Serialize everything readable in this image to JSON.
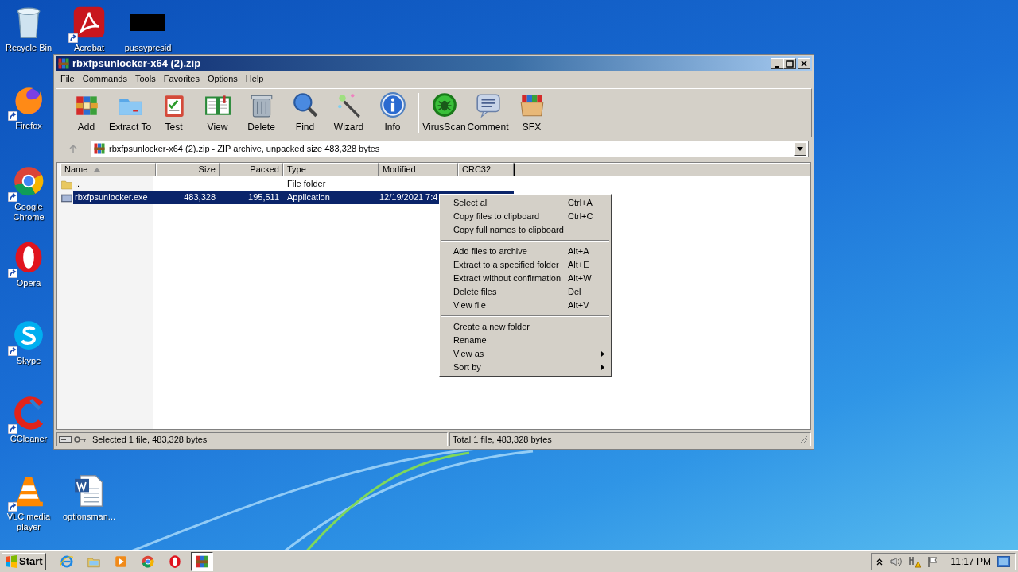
{
  "desktop_icons": [
    {
      "label": "Recycle Bin",
      "kind": "recycle",
      "shortcut": false
    },
    {
      "label": "Acrobat",
      "kind": "acrobat",
      "shortcut": true
    },
    {
      "label": "pussypresid",
      "kind": "blackout",
      "shortcut": false
    },
    {
      "label": "Firefox",
      "kind": "firefox",
      "shortcut": true
    },
    {
      "label": "Google Chrome",
      "kind": "chrome",
      "shortcut": true
    },
    {
      "label": "Opera",
      "kind": "opera",
      "shortcut": true
    },
    {
      "label": "Skype",
      "kind": "skype",
      "shortcut": true
    },
    {
      "label": "CCleaner",
      "kind": "ccleaner",
      "shortcut": true
    },
    {
      "label": "VLC media player",
      "kind": "vlc",
      "shortcut": true
    },
    {
      "label": "optionsman...",
      "kind": "word",
      "shortcut": false
    }
  ],
  "window": {
    "title": "rbxfpsunlocker-x64 (2).zip",
    "menu": [
      "File",
      "Commands",
      "Tools",
      "Favorites",
      "Options",
      "Help"
    ],
    "toolbar": [
      {
        "label": "Add",
        "kind": "add"
      },
      {
        "label": "Extract To",
        "kind": "extract"
      },
      {
        "label": "Test",
        "kind": "test"
      },
      {
        "label": "View",
        "kind": "view"
      },
      {
        "label": "Delete",
        "kind": "delete"
      },
      {
        "label": "Find",
        "kind": "find"
      },
      {
        "label": "Wizard",
        "kind": "wizard"
      },
      {
        "label": "Info",
        "kind": "info"
      },
      {
        "label": "VirusScan",
        "kind": "virus"
      },
      {
        "label": "Comment",
        "kind": "comment"
      },
      {
        "label": "SFX",
        "kind": "sfx"
      }
    ],
    "address": "rbxfpsunlocker-x64 (2).zip - ZIP archive, unpacked size 483,328 bytes",
    "columns": [
      {
        "label": "Name",
        "sorted": true
      },
      {
        "label": "Size",
        "sorted": false
      },
      {
        "label": "Packed",
        "sorted": false
      },
      {
        "label": "Type",
        "sorted": false
      },
      {
        "label": "Modified",
        "sorted": false
      },
      {
        "label": "CRC32",
        "sorted": false
      }
    ],
    "rows": [
      {
        "kind": "folder",
        "name": "..",
        "size": "",
        "packed": "",
        "type": "File folder",
        "modified": "",
        "selected": false
      },
      {
        "kind": "exe",
        "name": "rbxfpsunlocker.exe",
        "size": "483,328",
        "packed": "195,511",
        "type": "Application",
        "modified": "12/19/2021 7:4",
        "selected": true
      }
    ],
    "status_bar": [
      "Selected 1 file, 483,328 bytes",
      "Total 1 file, 483,328 bytes"
    ]
  },
  "context_menu": [
    [
      {
        "label": "Select all",
        "shortcut": "Ctrl+A",
        "submenu": false
      },
      {
        "label": "Copy files to clipboard",
        "shortcut": "Ctrl+C",
        "submenu": false
      },
      {
        "label": "Copy full names to clipboard",
        "submenu": false
      }
    ],
    [
      {
        "label": "Add files to archive",
        "shortcut": "Alt+A",
        "submenu": false
      },
      {
        "label": "Extract to a specified folder",
        "shortcut": "Alt+E",
        "submenu": false
      },
      {
        "label": "Extract without confirmation",
        "shortcut": "Alt+W",
        "submenu": false
      },
      {
        "label": "Delete files",
        "shortcut": "Del",
        "submenu": false
      },
      {
        "label": "View file",
        "shortcut": "Alt+V",
        "submenu": false
      }
    ],
    [
      {
        "label": "Create a new folder",
        "submenu": false
      },
      {
        "label": "Rename",
        "submenu": false
      },
      {
        "label": "View as",
        "submenu": true
      },
      {
        "label": "Sort by",
        "submenu": true
      }
    ]
  ],
  "taskbar": {
    "start": "Start",
    "apps": [
      {
        "kind": "ie",
        "active": false
      },
      {
        "kind": "explorer",
        "active": false
      },
      {
        "kind": "media",
        "active": false
      },
      {
        "kind": "chrome",
        "active": false
      },
      {
        "kind": "opera",
        "active": false
      },
      {
        "kind": "winrar",
        "active": true
      }
    ],
    "time": "11:17 PM"
  }
}
